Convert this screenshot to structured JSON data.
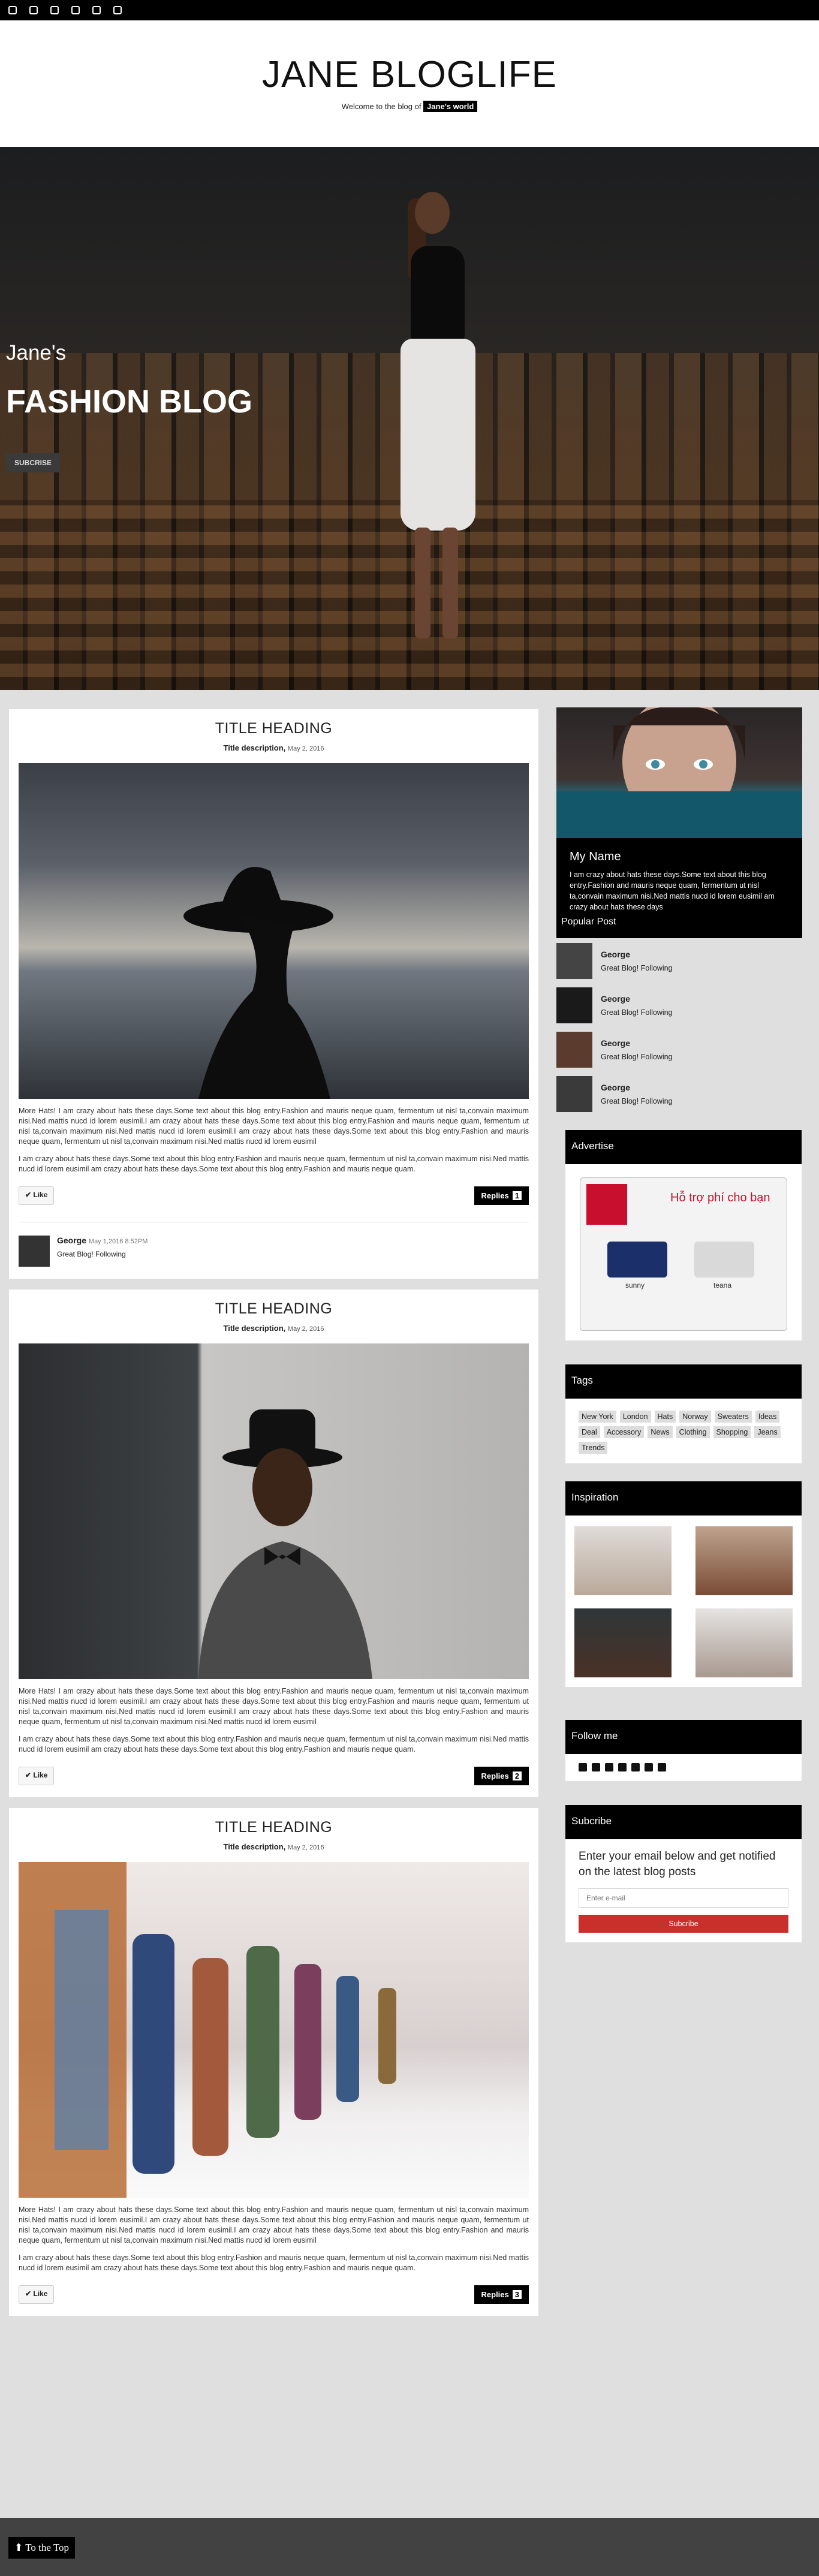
{
  "topbar": {
    "icons": [
      "facebook-icon",
      "instagram-icon",
      "github-icon",
      "flickr-icon",
      "twitter-icon",
      "linkedin-icon"
    ]
  },
  "header": {
    "title": "JANE BLOGLIFE",
    "welcome_prefix": "Welcome to the blog of",
    "welcome_badge": "Jane's world"
  },
  "hero": {
    "subtitle": "Jane's",
    "title": "FASHION BLOG",
    "button": "SUBCRISE"
  },
  "posts": [
    {
      "title": "TITLE HEADING",
      "desc": "Title description,",
      "date": "May 2, 2016",
      "p1": "More Hats! I am crazy about hats these days.Some text about this blog entry.Fashion and mauris neque quam, fermentum ut nisl ta,convain maximum nisi.Ned mattis nucd id lorem eusimil.I am crazy about hats these days.Some text about this blog entry.Fashion and mauris neque quam, fermentum ut nisl ta,convain maximum nisi.Ned mattis nucd id lorem eusimil.I am crazy about hats these days.Some text about this blog entry.Fashion and mauris neque quam, fermentum ut nisl ta,convain maximum nisi.Ned mattis nucd id lorem eusimil",
      "p2": "I am crazy about hats these days.Some text about this blog entry.Fashion and mauris neque quam, fermentum ut nisl ta,convain maximum nisi.Ned mattis nucd id lorem eusimil am crazy about hats these days.Some text about this blog entry.Fashion and mauris neque quam.",
      "like": "Like",
      "replies": "Replies",
      "count": "1"
    },
    {
      "title": "TITLE HEADING",
      "desc": "Title description,",
      "date": "May 2, 2016",
      "p1": "More Hats! I am crazy about hats these days.Some text about this blog entry.Fashion and mauris neque quam, fermentum ut nisl ta,convain maximum nisi.Ned mattis nucd id lorem eusimil.I am crazy about hats these days.Some text about this blog entry.Fashion and mauris neque quam, fermentum ut nisl ta,convain maximum nisi.Ned mattis nucd id lorem eusimil.I am crazy about hats these days.Some text about this blog entry.Fashion and mauris neque quam, fermentum ut nisl ta,convain maximum nisi.Ned mattis nucd id lorem eusimil",
      "p2": "I am crazy about hats these days.Some text about this blog entry.Fashion and mauris neque quam, fermentum ut nisl ta,convain maximum nisi.Ned mattis nucd id lorem eusimil am crazy about hats these days.Some text about this blog entry.Fashion and mauris neque quam.",
      "like": "Like",
      "replies": "Replies",
      "count": "2"
    },
    {
      "title": "TITLE HEADING",
      "desc": "Title description,",
      "date": "May 2, 2016",
      "p1": "More Hats! I am crazy about hats these days.Some text about this blog entry.Fashion and mauris neque quam, fermentum ut nisl ta,convain maximum nisi.Ned mattis nucd id lorem eusimil.I am crazy about hats these days.Some text about this blog entry.Fashion and mauris neque quam, fermentum ut nisl ta,convain maximum nisi.Ned mattis nucd id lorem eusimil.I am crazy about hats these days.Some text about this blog entry.Fashion and mauris neque quam, fermentum ut nisl ta,convain maximum nisi.Ned mattis nucd id lorem eusimil",
      "p2": "I am crazy about hats these days.Some text about this blog entry.Fashion and mauris neque quam, fermentum ut nisl ta,convain maximum nisi.Ned mattis nucd id lorem eusimil am crazy about hats these days.Some text about this blog entry.Fashion and mauris neque quam.",
      "like": "Like",
      "replies": "Replies",
      "count": "3"
    }
  ],
  "comment": {
    "name": "George",
    "date": "May 1,2016 8:52PM",
    "text": "Great Blog! Following"
  },
  "profile": {
    "name": "My Name",
    "bio": "I am crazy about hats these days.Some text about this blog entry.Fashion and mauris neque quam, fermentum ut nisl ta,convain maximum nisi.Ned mattis nucd id lorem eusimil am crazy about hats these days"
  },
  "popular": {
    "title": "Popular Post",
    "items": [
      {
        "name": "George",
        "text": "Great Blog! Following"
      },
      {
        "name": "George",
        "text": "Great Blog! Following"
      },
      {
        "name": "George",
        "text": "Great Blog! Following"
      },
      {
        "name": "George",
        "text": "Great Blog! Following"
      }
    ]
  },
  "advertise": {
    "title": "Advertise",
    "caption": "Hỗ trợ phí cho bạn",
    "car1": "sunny",
    "car2": "teana"
  },
  "tags": {
    "title": "Tags",
    "items": [
      "New York",
      "London",
      "Hats",
      "Norway",
      "Sweaters",
      "Ideas",
      "Deal",
      "Accessory",
      "News",
      "Clothing",
      "Shopping",
      "Jeans",
      "Trends"
    ]
  },
  "inspiration": {
    "title": "Inspiration"
  },
  "follow": {
    "title": "Follow me"
  },
  "subscribe": {
    "title": "Subcribe",
    "text": "Enter your email below and get notified on the latest blog posts",
    "placeholder": "Enter e-mail",
    "button": "Subcribe"
  },
  "footer": {
    "to_top": "To the Top"
  }
}
